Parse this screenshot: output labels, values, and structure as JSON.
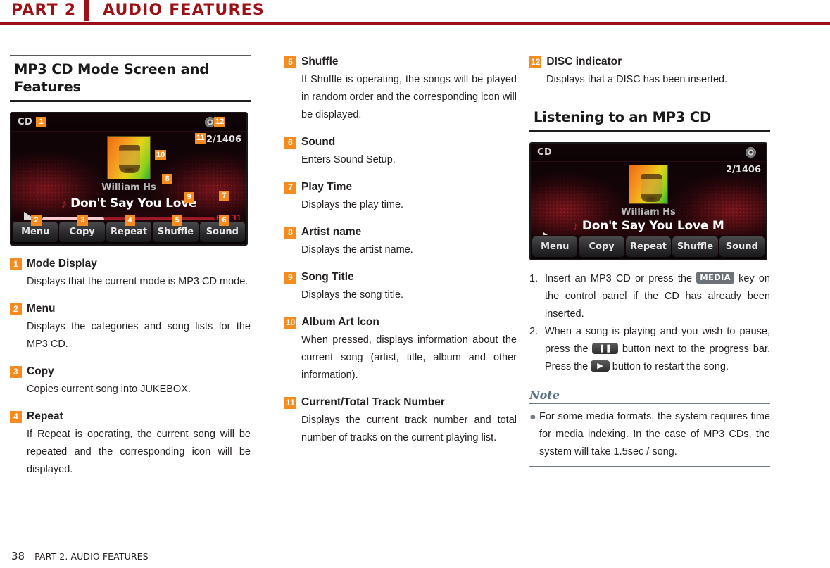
{
  "header": {
    "part": "PART 2",
    "title": "AUDIO FEATURES"
  },
  "footer": {
    "page": "38",
    "label": "PART 2. AUDIO FEATURES"
  },
  "colors": {
    "header_red": "#9C1116",
    "badge_orange": "#F68B1F",
    "note_blue": "#5B7287"
  },
  "sections": {
    "features_heading": "MP3 CD Mode Screen and Features",
    "listening_heading": "Listening to an MP3 CD"
  },
  "device_screen": {
    "mode_label": "CD",
    "disc_icon": "disc-icon",
    "track_number": "2/1406",
    "artist": "William Hs",
    "song_title_full": "Don't Say You Love",
    "song_title_truncated": "Don't Say You Love M",
    "music_note_icon": "music-note-icon",
    "play_icon": "play-icon",
    "play_time": "01:31",
    "buttons": [
      "Menu",
      "Copy",
      "Repeat",
      "Shuffle",
      "Sound"
    ],
    "callouts": [
      "1",
      "2",
      "3",
      "4",
      "5",
      "6",
      "7",
      "8",
      "9",
      "10",
      "11",
      "12"
    ]
  },
  "features": [
    {
      "num": "1",
      "title": "Mode Display",
      "body": "Displays that the current mode is MP3 CD mode."
    },
    {
      "num": "2",
      "title": "Menu",
      "body": "Displays the categories and song lists for the MP3 CD."
    },
    {
      "num": "3",
      "title": "Copy",
      "body": "Copies current song into JUKEBOX."
    },
    {
      "num": "4",
      "title": "Repeat",
      "body": "If Repeat is operating, the current song will be repeated and the corresponding icon will be displayed."
    },
    {
      "num": "5",
      "title": "Shuffle",
      "body": "If Shuffle is operating, the songs will be played in random order and the corresponding icon will be displayed."
    },
    {
      "num": "6",
      "title": "Sound",
      "body": "Enters Sound Setup."
    },
    {
      "num": "7",
      "title": "Play Time",
      "body": "Displays the play time."
    },
    {
      "num": "8",
      "title": "Artist name",
      "body": "Displays the artist name."
    },
    {
      "num": "9",
      "title": "Song Title",
      "body": "Displays the song title."
    },
    {
      "num": "10",
      "title": "Album Art Icon",
      "body": "When pressed, displays information about the current song (artist, title, album and other information)."
    },
    {
      "num": "11",
      "title": "Current/Total Track Number",
      "body": "Displays the current track number and total number of tracks on the current playing list."
    },
    {
      "num": "12",
      "title": "DISC indicator",
      "body": "Displays that a DISC has been inserted."
    }
  ],
  "steps": [
    {
      "num": "1.",
      "part_a": "Insert an MP3 CD or press the",
      "key": "MEDIA",
      "part_b": "key on the control panel if the CD has already been inserted."
    },
    {
      "num": "2.",
      "part_a": "When a song is playing and you wish to pause, press the",
      "key_pause": "❚❚",
      "part_b": "button next to the progress bar. Press the",
      "key_play": "▶",
      "part_c": "button to restart the song."
    }
  ],
  "note": {
    "title": "Note",
    "bullet": "For some media formats, the system requires time for media indexing. In the case of MP3 CDs, the system will take 1.5sec / song."
  }
}
